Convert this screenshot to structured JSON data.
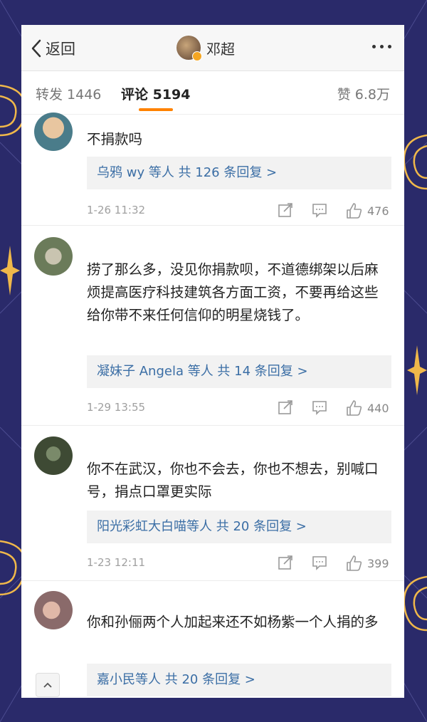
{
  "header": {
    "back_label": "返回",
    "title": "邓超"
  },
  "tabs": {
    "repost": "转发 1446",
    "comments": "评论 5194",
    "likes": "赞 6.8万"
  },
  "comments": [
    {
      "text": "不捐款吗",
      "replies": "乌鸦 wy 等人  共 126 条回复 >",
      "time": "1-26 11:32",
      "likes": "476"
    },
    {
      "text": "捞了那么多，没见你捐款呗，不道德绑架以后麻烦提高医疗科技建筑各方面工资，不要再给这些给你带不来任何信仰的明星烧钱了。",
      "replies": "凝妹子 Angela 等人  共 14 条回复 >",
      "time": "1-29 13:55",
      "likes": "440"
    },
    {
      "text": "你不在武汉，你也不会去，你也不想去，别喊口号，捐点口罩更实际",
      "replies": "阳光彩虹大白喵等人  共 20 条回复 >",
      "time": "1-23 12:11",
      "likes": "399"
    },
    {
      "text": "你和孙俪两个人加起来还不如杨紫一个人捐的多",
      "replies": "嘉小民等人  共 20 条回复 >",
      "time": "",
      "likes": ""
    }
  ],
  "colors": {
    "accent": "#ff8200",
    "link": "#3b6ea5",
    "background": "#2a2a6a",
    "ornament": "#f0b84a"
  }
}
